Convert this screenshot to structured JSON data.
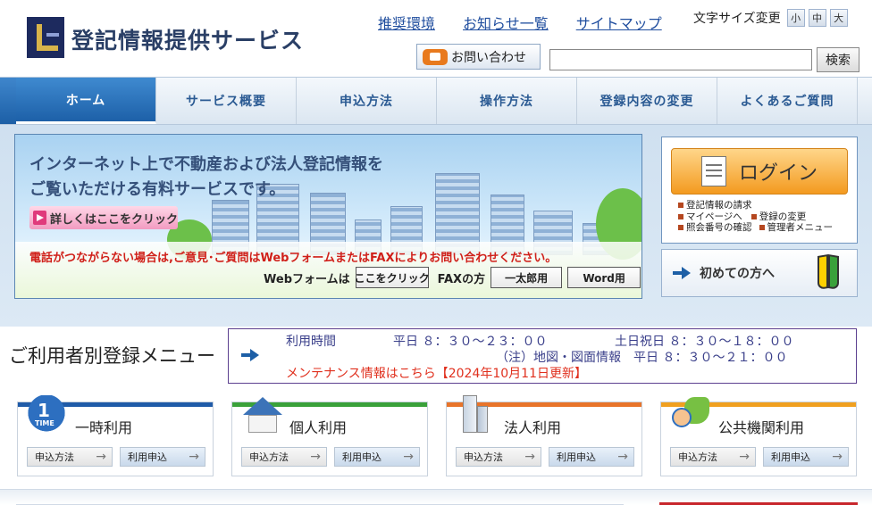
{
  "header": {
    "site_title": "登記情報提供サービス",
    "links": [
      "推奨環境",
      "お知らせ一覧",
      "サイトマップ"
    ],
    "font_size_label": "文字サイズ変更",
    "font_sizes": [
      "小",
      "中",
      "大"
    ],
    "contact_label": "お問い合わせ",
    "search_placeholder": "",
    "search_button": "検索"
  },
  "nav": {
    "items": [
      "ホーム",
      "サービス概要",
      "申込方法",
      "操作方法",
      "登録内容の変更",
      "よくあるご質問"
    ]
  },
  "hero": {
    "headline_1": "インターネット上で不動産および法人登記情報を",
    "headline_2": "ご覧いただける有料サービスです。",
    "detail_link": "詳しくはここをクリック",
    "warning": "電話がつながらない場合は,ご意見･ご質問はWebフォームまたはFAXによりお問い合わせください。",
    "webform_label": "Webフォームは",
    "webform_button": "ここをクリック",
    "fax_label": "FAXの方",
    "fax_ichitaro": "一太郎用",
    "fax_word": "Word用"
  },
  "login": {
    "button": "ログイン",
    "links": [
      "登記情報の請求",
      "マイページへ",
      "照会番号の確認"
    ],
    "links_right": [
      "登録の変更",
      "管理者メニュー"
    ],
    "first_time": "初めての方へ"
  },
  "registration": {
    "title": "ご利用者別登録メニュー",
    "hours_label": "利用時間",
    "weekday": "平日 ８：３０～２３：００",
    "weekend": "土日祝日 ８：３０～１８：００",
    "note": "（注）地図・図面情報　平日 ８：３０～２１：００",
    "maintenance": "メンテナンス情報はこちら【2024年10月11日更新】"
  },
  "cards": [
    {
      "title": "一時利用",
      "icon_text_1": "1",
      "icon_text_2": "TIME",
      "color": "#1f5ba8",
      "btn1": "申込方法",
      "btn2": "利用申込"
    },
    {
      "title": "個人利用",
      "color": "#3aa13a",
      "btn1": "申込方法",
      "btn2": "利用申込"
    },
    {
      "title": "法人利用",
      "color": "#e8742a",
      "btn1": "申込方法",
      "btn2": "利用申込"
    },
    {
      "title": "公共機関利用",
      "color": "#f0a020",
      "btn1": "申込方法",
      "btn2": "利用申込"
    }
  ],
  "colors": {
    "nav_active": "#1d60a8",
    "login_orange": "#f39a1f",
    "warning_red": "#d0201a",
    "maintenance_red": "#e0301e"
  }
}
